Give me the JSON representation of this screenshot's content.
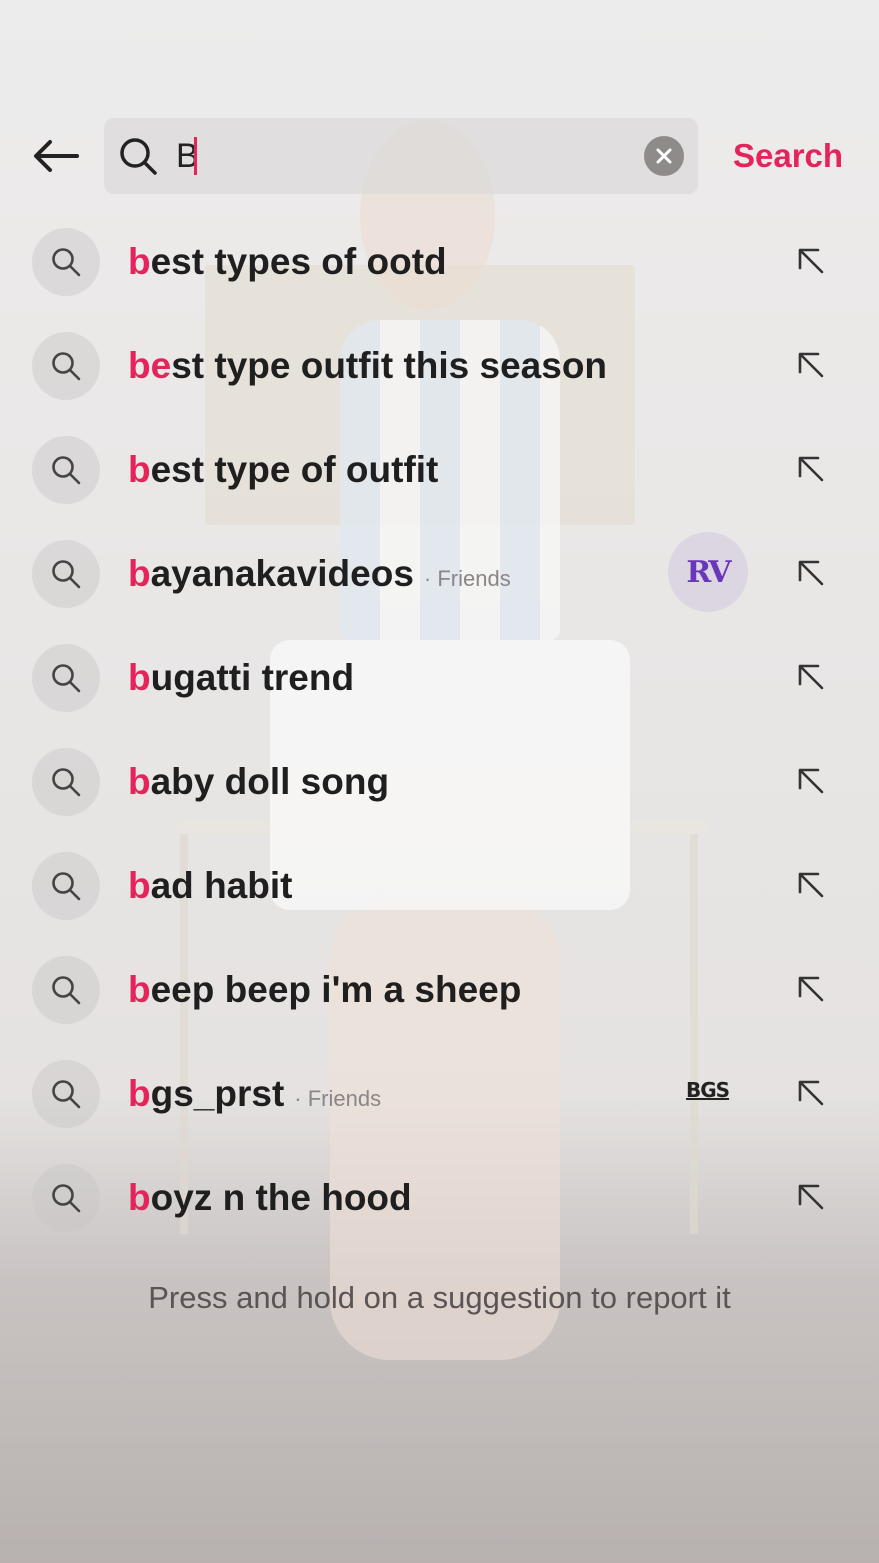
{
  "search": {
    "value": "B",
    "submit_label": "Search"
  },
  "suggestions": [
    {
      "prefix": "b",
      "rest": "est types of ootd",
      "tag": "",
      "avatar": ""
    },
    {
      "prefix": "be",
      "rest": "st type outfit this season",
      "tag": "",
      "avatar": ""
    },
    {
      "prefix": "b",
      "rest": "est type of outfit",
      "tag": "",
      "avatar": ""
    },
    {
      "prefix": "b",
      "rest": "ayanakavideos",
      "tag": "· Friends",
      "avatar": "RV"
    },
    {
      "prefix": "b",
      "rest": "ugatti trend",
      "tag": "",
      "avatar": ""
    },
    {
      "prefix": "b",
      "rest": "aby doll song",
      "tag": "",
      "avatar": ""
    },
    {
      "prefix": "b",
      "rest": "ad habit",
      "tag": "",
      "avatar": ""
    },
    {
      "prefix": "b",
      "rest": "eep beep i'm a sheep",
      "tag": "",
      "avatar": ""
    },
    {
      "prefix": "b",
      "rest": "gs_prst",
      "tag": "· Friends",
      "avatar": "BGS"
    },
    {
      "prefix": "b",
      "rest": "oyz n the hood",
      "tag": "",
      "avatar": ""
    }
  ],
  "footer_note": "Press and hold on a suggestion to report it",
  "colors": {
    "accent": "#e4245a",
    "text": "#1f1f1f",
    "muted": "#8a8686"
  },
  "icons": {
    "back": "arrow-left-icon",
    "search": "magnifier-icon",
    "clear": "x-circle-icon",
    "fill": "arrow-up-left-icon"
  }
}
